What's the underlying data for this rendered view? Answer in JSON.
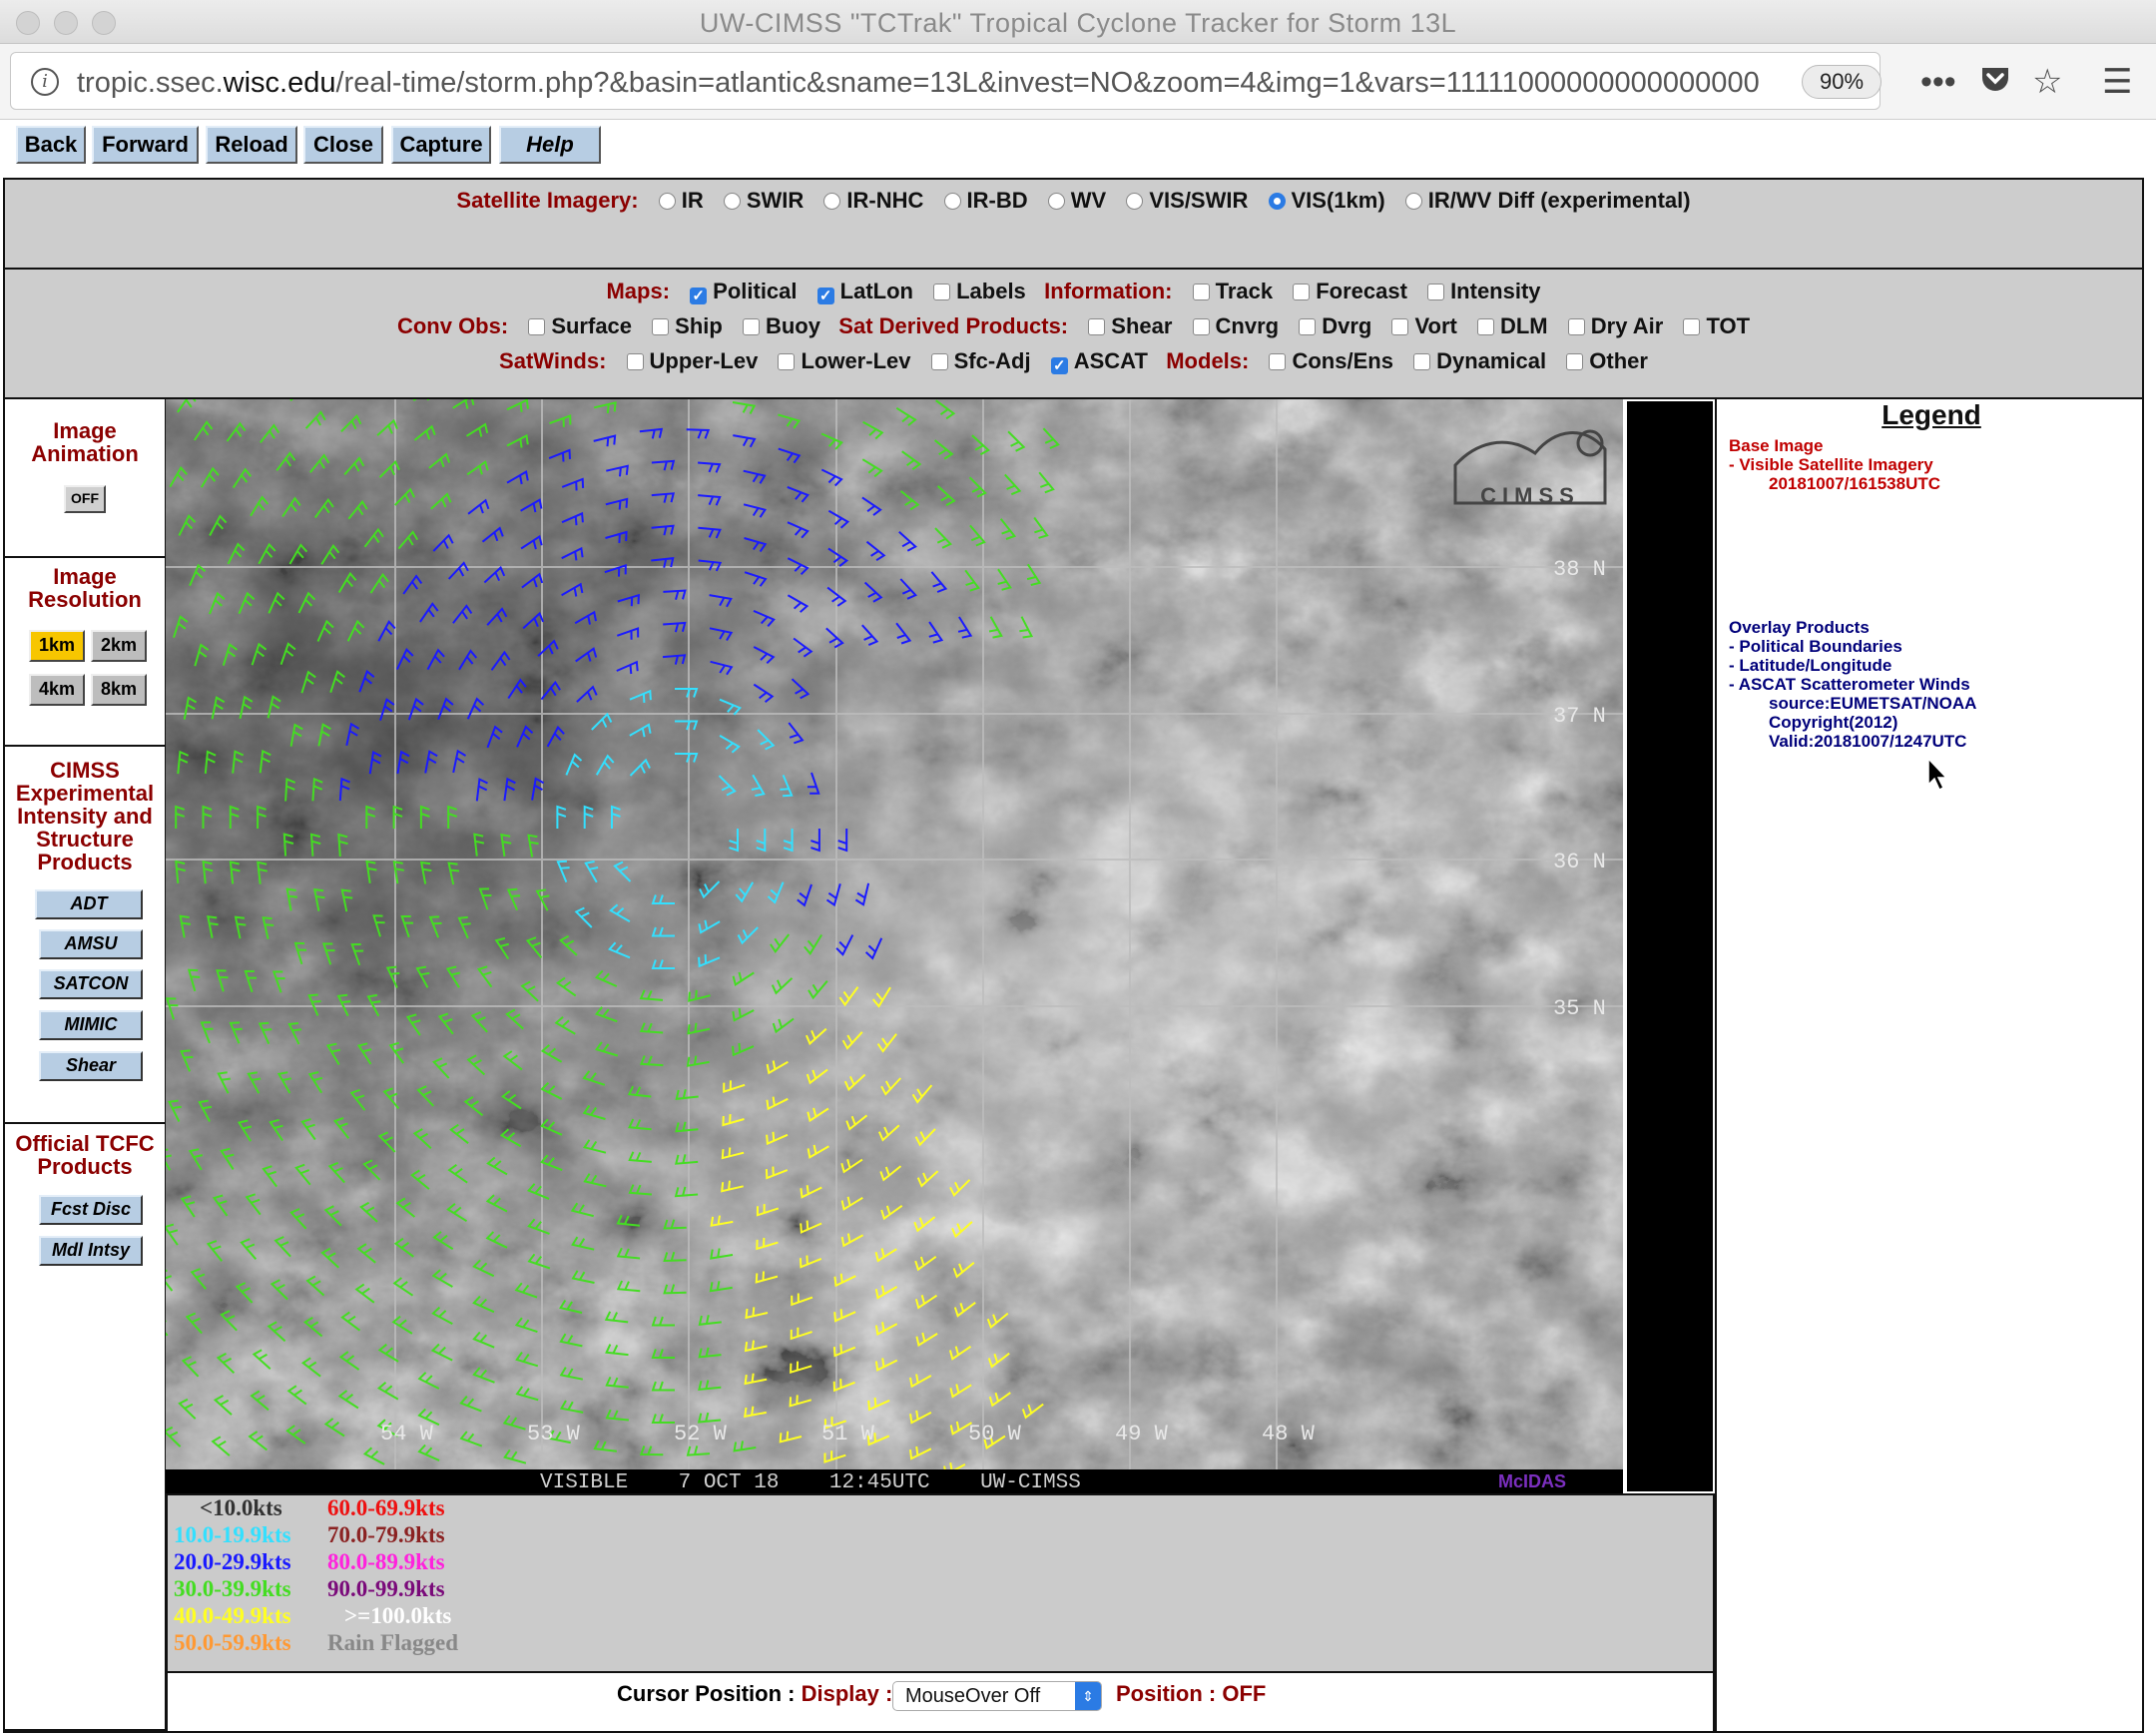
{
  "window": {
    "title": "UW-CIMSS \"TCTrak\" Tropical Cyclone Tracker for Storm 13L",
    "url_prefix": "tropic.ssec.",
    "url_domain": "wisc.edu",
    "url_rest": "/real-time/storm.php?&basin=atlantic&sname=13L&invest=NO&zoom=4&img=1&vars=11111000000000000000",
    "zoom": "90%"
  },
  "toolbar": {
    "back": "Back",
    "forward": "Forward",
    "reload": "Reload",
    "close": "Close",
    "capture": "Capture",
    "help": "Help"
  },
  "imagery": {
    "label": "Satellite Imagery:",
    "options": [
      "IR",
      "SWIR",
      "IR-NHC",
      "IR-BD",
      "WV",
      "VIS/SWIR",
      "VIS(1km)",
      "IR/WV Diff (experimental)"
    ],
    "selected": "VIS(1km)"
  },
  "maps": {
    "label": "Maps:",
    "political": "Political",
    "latlon": "LatLon",
    "labels": "Labels"
  },
  "information": {
    "label": "Information:",
    "track": "Track",
    "forecast": "Forecast",
    "intensity": "Intensity"
  },
  "conv_obs": {
    "label": "Conv Obs:",
    "surface": "Surface",
    "ship": "Ship",
    "buoy": "Buoy"
  },
  "sat_derived": {
    "label": "Sat Derived Products:",
    "shear": "Shear",
    "cnvrg": "Cnvrg",
    "dvrg": "Dvrg",
    "vort": "Vort",
    "dlm": "DLM",
    "dryair": "Dry Air",
    "tot": "TOT"
  },
  "satwinds": {
    "label": "SatWinds:",
    "upper": "Upper-Lev",
    "lower": "Lower-Lev",
    "sfcadj": "Sfc-Adj",
    "ascat": "ASCAT"
  },
  "models": {
    "label": "Models:",
    "cons": "Cons/Ens",
    "dynamical": "Dynamical",
    "other": "Other"
  },
  "sidebar": {
    "animation_title": "Image Animation",
    "animation_btn": "OFF",
    "resolution_title": "Image Resolution",
    "res": [
      "1km",
      "2km",
      "4km",
      "8km"
    ],
    "cimss_title": "CIMSS Experimental Intensity and Structure Products",
    "cimss_buttons": [
      "ADT",
      "AMSU",
      "SATCON",
      "MIMIC",
      "Shear"
    ],
    "official_title": "Official TCFC Products",
    "official_buttons": [
      "Fcst Disc",
      "Mdl Intsy"
    ]
  },
  "image": {
    "lat_labels": [
      "38 N",
      "37 N",
      "36 N",
      "35 N"
    ],
    "lon_labels": [
      "54 W",
      "53 W",
      "52 W",
      "51 W",
      "50 W",
      "49 W",
      "48 W"
    ],
    "footer": "VISIBLE    7 OCT 18    12:45UTC    UW-CIMSS",
    "mcidas": "McIDAS",
    "logo": "CIMSS"
  },
  "legend": {
    "title": "Legend",
    "base_heading": "Base Image",
    "base_item": "-  Visible Satellite Imagery",
    "base_time": "20181007/161538UTC",
    "overlay_heading": "Overlay Products",
    "overlay_items": [
      "-  Political Boundaries",
      "-  Latitude/Longitude",
      "-  ASCAT Scatterometer Winds"
    ],
    "ascat_source": "source:EUMETSAT/NOAA",
    "ascat_copyright": "Copyright(2012)",
    "ascat_valid": "Valid:20181007/1247UTC"
  },
  "wind_key": [
    {
      "text": "<10.0kts",
      "color": "#333333"
    },
    {
      "text": "10.0-19.9kts",
      "color": "#33e0ff"
    },
    {
      "text": "20.0-29.9kts",
      "color": "#1a1aff"
    },
    {
      "text": "30.0-39.9kts",
      "color": "#44dd22"
    },
    {
      "text": "40.0-49.9kts",
      "color": "#ffff22"
    },
    {
      "text": "50.0-59.9kts",
      "color": "#ff9933"
    },
    {
      "text": "60.0-69.9kts",
      "color": "#ee1111"
    },
    {
      "text": "70.0-79.9kts",
      "color": "#8b2222"
    },
    {
      "text": "80.0-89.9kts",
      "color": "#ff22dd"
    },
    {
      "text": "90.0-99.9kts",
      "color": "#7a0a7a"
    },
    {
      "text": ">=100.0kts",
      "color": "#ffffff"
    },
    {
      "text": "Rain Flagged",
      "color": "#888888"
    }
  ],
  "cursor": {
    "label": "Cursor Position :",
    "display_label": "Display :",
    "display_value": "MouseOver Off",
    "position_label": "Position : OFF"
  }
}
